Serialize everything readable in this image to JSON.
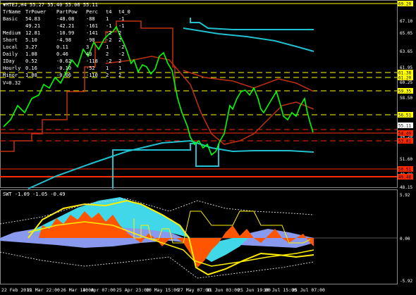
{
  "window": {
    "symbol_header": "▼MTEJ,H4  55.27 55.40 55.06 55.11"
  },
  "info_table": {
    "headers": [
      "TrName",
      "TrPower",
      "PartPow",
      "Perc",
      "t4",
      "t4_0"
    ],
    "rows": [
      [
        "Basic",
        "54.83",
        "-48.08",
        "-88",
        "1",
        "-1"
      ],
      [
        "",
        "49.21",
        "-42.21",
        "-161",
        "-1",
        "-1"
      ],
      [
        "Medium",
        "12.81",
        "-10.99",
        "-141",
        "-2",
        "2"
      ],
      [
        "Short",
        "5.10",
        "-4.98",
        "-98",
        "-2",
        "2"
      ],
      [
        "Local",
        "3.27",
        "0.11",
        "3",
        "1",
        "-2"
      ],
      [
        "Daily",
        "1.08",
        "0.46",
        "43",
        "2",
        "-2"
      ],
      [
        "IDay",
        "0.52",
        "-0.62",
        "-118",
        "-2",
        "2"
      ],
      [
        "Hourly",
        "0.16",
        "-0.10",
        "-52",
        "1",
        "1"
      ],
      [
        "Minor",
        "1.08",
        "-0.06",
        "-110",
        "2",
        "2"
      ]
    ],
    "v_label": "V=0.32"
  },
  "price_axis": {
    "ticks": [
      "67.10",
      "65.05",
      "63.65",
      "61.95",
      "60.25",
      "58.50",
      "56.55",
      "54.20",
      "51.60",
      "49.90",
      "48.15"
    ]
  },
  "price_badges": [
    {
      "label": "69.20",
      "color": "#ffff00"
    },
    {
      "label": "61.38",
      "color": "#ffff00"
    },
    {
      "label": "61.20",
      "color": "#ffff00"
    },
    {
      "label": "59.35",
      "color": "#ffff00"
    },
    {
      "label": "56.51",
      "color": "#ffff00"
    },
    {
      "label": "55.11",
      "color": "#ffffff"
    },
    {
      "label": "54.49",
      "color": "#ff2a00"
    },
    {
      "label": "53.01",
      "color": "#ff2a00"
    },
    {
      "label": "50.51",
      "color": "#ff2a00"
    },
    {
      "label": "49.48",
      "color": "#ff2a00"
    }
  ],
  "indicator": {
    "header": "SWT -1.09 -1.05 -0.49",
    "ticks": [
      "5.92",
      "0.00",
      "-5.92"
    ]
  },
  "time_axis": {
    "labels": [
      "22 Feb 2019",
      "11 Mar 22:00",
      "26 Mar 14:00",
      "10 Apr 07:00",
      "25 Apr 23:00",
      "10 May 15:00",
      "27 May 07:00",
      "11 Jun 03:00",
      "25 Jun 19:00",
      "10 Jul 15:00",
      "25 Jul 07:00"
    ]
  },
  "colors": {
    "background": "#000000",
    "candles": "#00ff00",
    "ma_cyan": "#20c0d0",
    "ma_red": "#c03010",
    "level_yellow": "#ffff00",
    "level_red": "#ff2a00",
    "hist_orange": "#ff5500",
    "hist_cyan": "#40d8e8",
    "hist_blue": "#8899ee",
    "band_yellow": "#ffee00"
  }
}
